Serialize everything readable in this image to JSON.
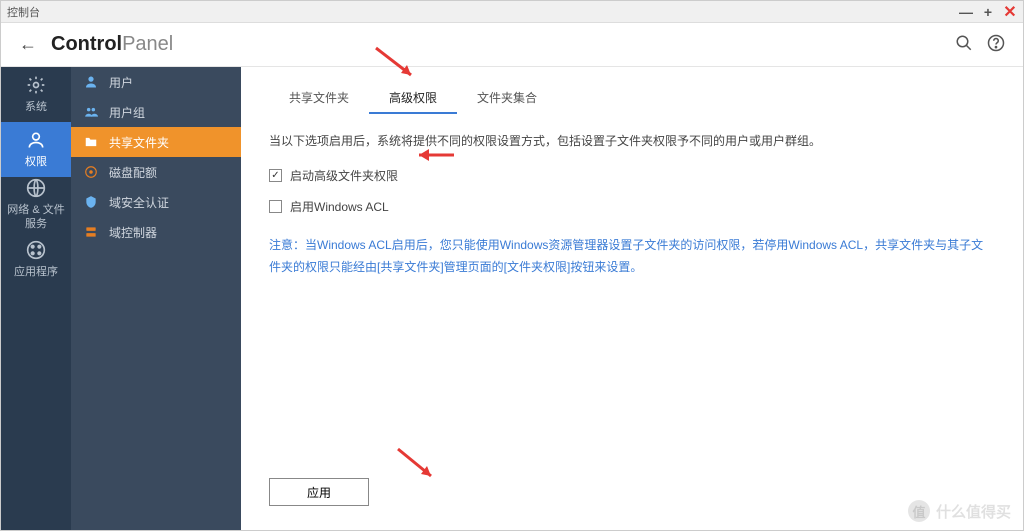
{
  "window": {
    "title": "控制台"
  },
  "header": {
    "brand_bold": "Control",
    "brand_light": "Panel"
  },
  "primary_nav": [
    {
      "icon": "gear",
      "label": "系统"
    },
    {
      "icon": "user",
      "label": "权限",
      "active": true
    },
    {
      "icon": "globe",
      "label": "网络 & 文件服务"
    },
    {
      "icon": "grid",
      "label": "应用程序"
    }
  ],
  "secondary_nav": [
    {
      "icon": "user",
      "label": "用户"
    },
    {
      "icon": "users",
      "label": "用户组"
    },
    {
      "icon": "folder",
      "label": "共享文件夹",
      "active": true
    },
    {
      "icon": "disk",
      "label": "磁盘配额"
    },
    {
      "icon": "shield",
      "label": "域安全认证"
    },
    {
      "icon": "server",
      "label": "域控制器"
    }
  ],
  "tabs": [
    {
      "label": "共享文件夹"
    },
    {
      "label": "高级权限",
      "active": true
    },
    {
      "label": "文件夹集合"
    }
  ],
  "content": {
    "intro": "当以下选项启用后，系统将提供不同的权限设置方式，包括设置子文件夹权限予不同的用户或用户群组。",
    "checkbox1": {
      "label": "启动高级文件夹权限",
      "checked": true
    },
    "checkbox2": {
      "label": "启用Windows ACL",
      "checked": false
    },
    "note": "注意：当Windows ACL启用后，您只能使用Windows资源管理器设置子文件夹的访问权限，若停用Windows ACL，共享文件夹与其子文件夹的权限只能经由[共享文件夹]管理页面的[文件夹权限]按钮来设置。"
  },
  "footer": {
    "apply": "应用"
  },
  "watermark": "什么值得买"
}
